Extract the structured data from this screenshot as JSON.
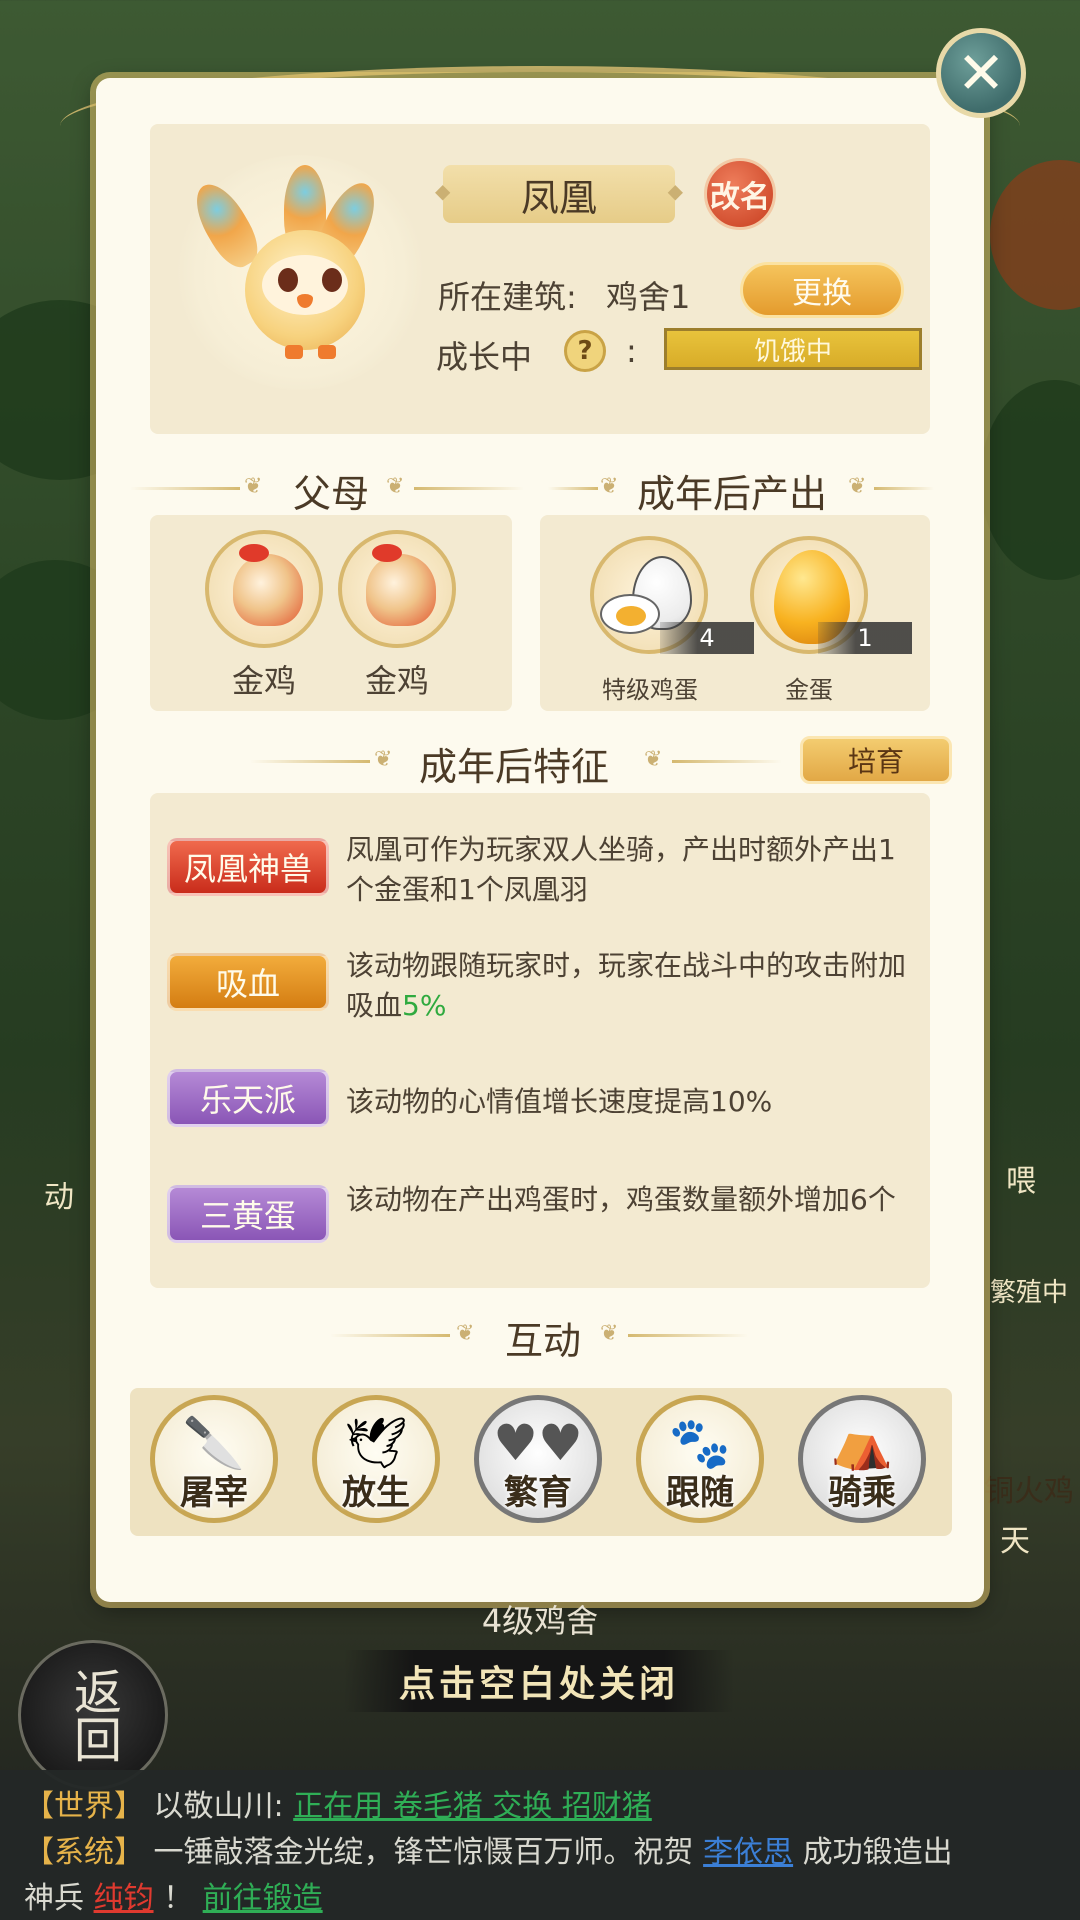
{
  "modal": {
    "close_symbol": "✕",
    "animal": {
      "name": "凤凰",
      "rename_label": "改名",
      "building_label": "所在建筑:",
      "building_value": "鸡舍1",
      "change_label": "更换",
      "growth_label": "成长中",
      "help_symbol": "?",
      "colon": ":",
      "status": "饥饿中"
    },
    "parents": {
      "title": "父母",
      "items": [
        {
          "name": "金鸡",
          "icon": "golden-rooster-icon"
        },
        {
          "name": "金鸡",
          "icon": "golden-rooster-icon"
        }
      ]
    },
    "products": {
      "title": "成年后产出",
      "items": [
        {
          "name": "特级鸡蛋",
          "count": "4",
          "icon": "premium-egg-icon"
        },
        {
          "name": "金蛋",
          "count": "1",
          "icon": "golden-egg-icon"
        }
      ]
    },
    "traits": {
      "title": "成年后特征",
      "breed_label": "培育",
      "items": [
        {
          "tag": "凤凰神兽",
          "color": "#d8402a",
          "desc": "凤凰可作为玩家双人坐骑，产出时额外产出1个金蛋和1个凤凰羽"
        },
        {
          "tag": "吸血",
          "color": "#e39222",
          "desc_prefix": "该动物跟随玩家时，玩家在战斗中的攻击附加吸血",
          "desc_highlight": "5%"
        },
        {
          "tag": "乐天派",
          "color": "#9e6cc6",
          "desc": "该动物的心情值增长速度提高10%"
        },
        {
          "tag": "三黄蛋",
          "color": "#9e6cc6",
          "desc": "该动物在产出鸡蛋时，鸡蛋数量额外增加6个"
        }
      ]
    },
    "interaction": {
      "title": "互动",
      "actions": [
        {
          "label": "屠宰",
          "icon": "cleaver-icon"
        },
        {
          "label": "放生",
          "icon": "bird-release-icon"
        },
        {
          "label": "繁育",
          "icon": "hearts-icon"
        },
        {
          "label": "跟随",
          "icon": "paw-print-icon"
        },
        {
          "label": "骑乘",
          "icon": "saddle-icon"
        }
      ]
    }
  },
  "background": {
    "level_label": "4级鸡舍",
    "close_hint": "点击空白处关闭",
    "back_label": "返回",
    "side_fragments": [
      "动",
      "喂",
      "繁殖中",
      "铜火鸡",
      "天"
    ]
  },
  "chat": {
    "line1": {
      "tag": "【世界】",
      "user": "以敬山川:",
      "link": "正在用 卷毛猪 交换 招财猪"
    },
    "line2": {
      "tag": "【系统】",
      "text": "一锤敲落金光绽，锋芒惊慑百万师。祝贺",
      "player": "李依思",
      "text2": "成功锻造出"
    },
    "line3": {
      "prefix": "神兵",
      "weapon": "纯钧",
      "bang": "！",
      "link": "前往锻造"
    }
  }
}
